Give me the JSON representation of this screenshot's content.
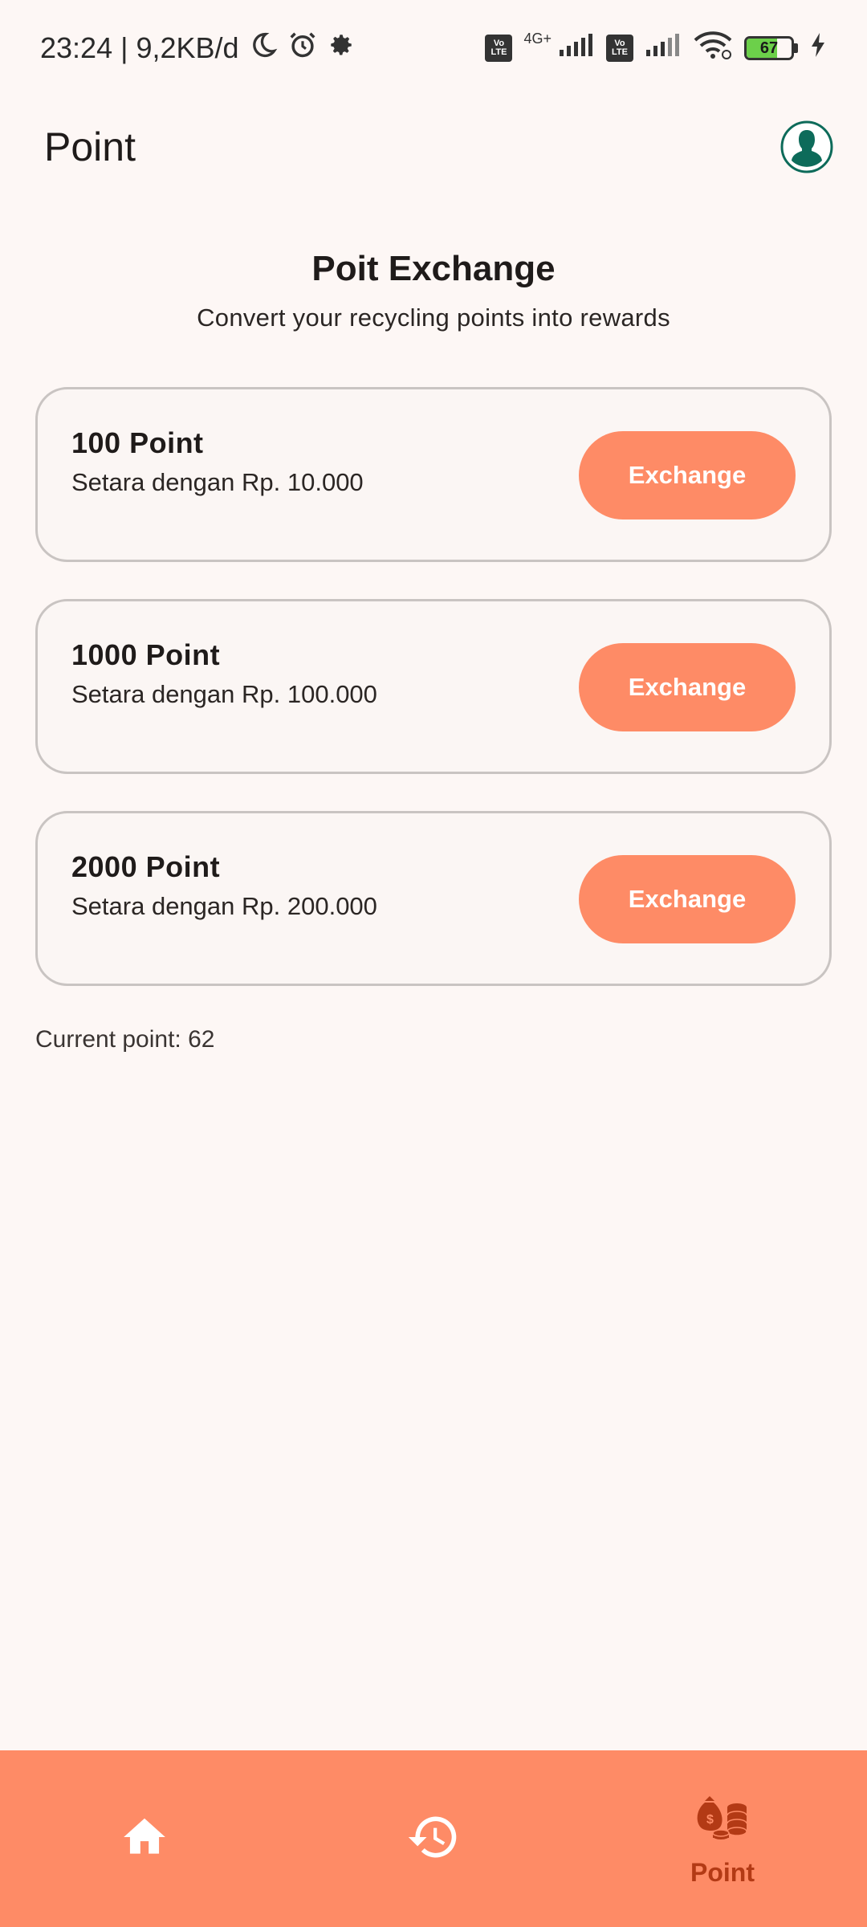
{
  "status_bar": {
    "time_speed": "23:24 | 9,2KB/d",
    "network_type": "4G+",
    "volte_label_top": "Vo",
    "volte_label_bottom": "LTE",
    "battery_level": "67",
    "battery_fraction": 0.67
  },
  "app_bar": {
    "title": "Point",
    "avatar_icon": "user-avatar-icon"
  },
  "header": {
    "title": "Poit Exchange",
    "subtitle": "Convert your recycling points into rewards"
  },
  "options": [
    {
      "title": "100 Point",
      "description": "Setara dengan Rp. 10.000",
      "button_label": "Exchange"
    },
    {
      "title": "1000 Point",
      "description": "Setara dengan Rp. 100.000",
      "button_label": "Exchange"
    },
    {
      "title": "2000 Point",
      "description": "Setara dengan Rp. 200.000",
      "button_label": "Exchange"
    }
  ],
  "current_point": "Current point: 62",
  "bottom_nav": {
    "items": [
      {
        "icon": "home-icon",
        "label": ""
      },
      {
        "icon": "history-icon",
        "label": ""
      },
      {
        "icon": "coins-moneybag-icon",
        "label": "Point",
        "active": true
      }
    ]
  },
  "colors": {
    "accent": "#fe8b66",
    "active_nav": "#b33a15",
    "background": "#fdf7f5",
    "avatar": "#0d6b5a"
  }
}
